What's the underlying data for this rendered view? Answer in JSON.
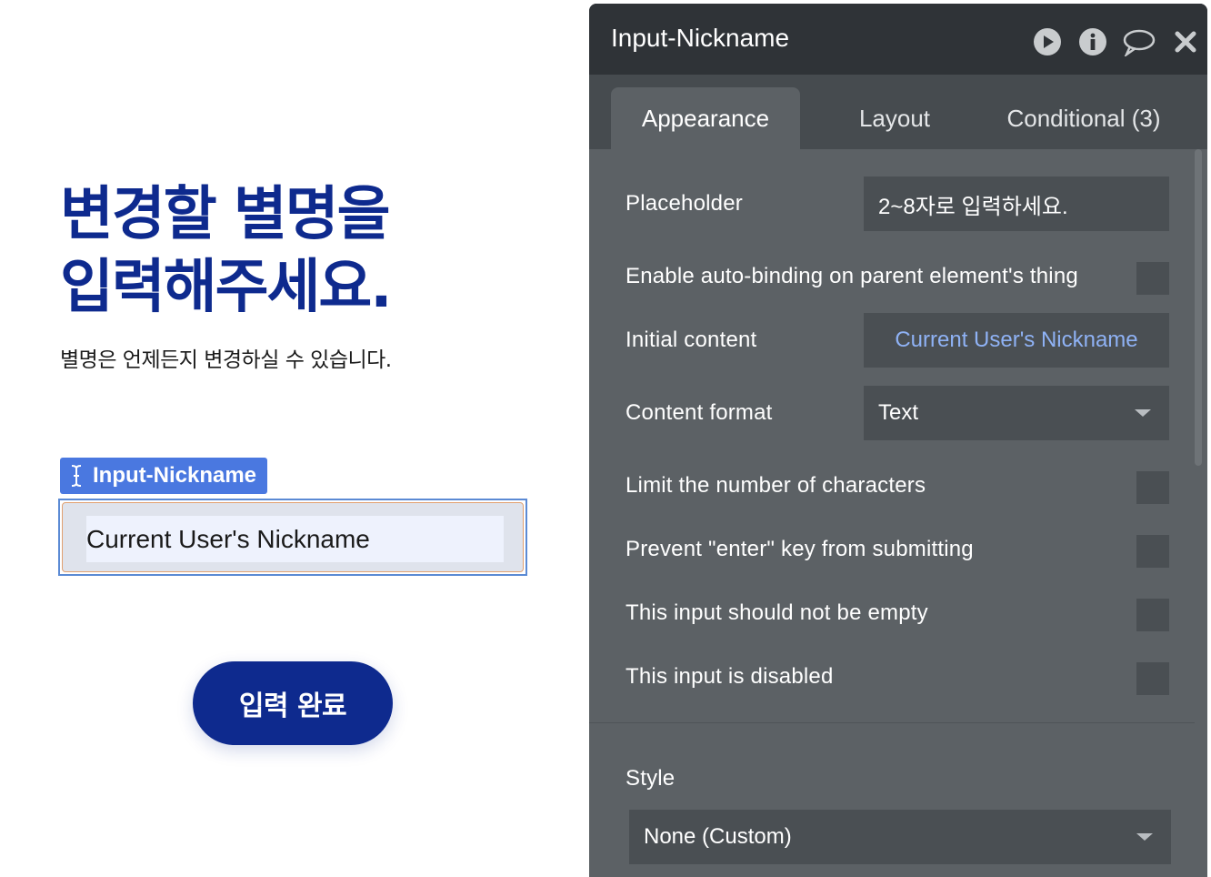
{
  "canvas": {
    "heading_line1": "변경할 별명을",
    "heading_line2": "입력해주세요.",
    "subtext": "별명은 언제든지 변경하실 수 있습니다.",
    "element_tag": "Input-Nickname",
    "input_value": "Current User's Nickname",
    "submit_label": "입력 완료"
  },
  "panel": {
    "title": "Input-Nickname",
    "header_icons": [
      "play-icon",
      "info-icon",
      "comment-icon",
      "close-icon"
    ],
    "tabs": [
      {
        "label": "Appearance",
        "active": true
      },
      {
        "label": "Layout",
        "active": false
      },
      {
        "label": "Conditional (3)",
        "active": false
      }
    ],
    "placeholder_label": "Placeholder",
    "placeholder_value": "2~8자로 입력하세요.",
    "autobinding_label": "Enable auto-binding on parent element's thing",
    "initial_content_label": "Initial content",
    "initial_content_value": "Current User's Nickname",
    "content_format_label": "Content format",
    "content_format_value": "Text",
    "limit_chars_label": "Limit the number of characters",
    "prevent_enter_label": "Prevent \"enter\" key from submitting",
    "not_empty_label": "This input should not be empty",
    "disabled_label": "This input is disabled",
    "style_label": "Style",
    "style_value": "None (Custom)"
  },
  "colors": {
    "brand_navy": "#0e2a8e",
    "tag_blue": "#4a78e0",
    "panel_bg": "#5c6165",
    "panel_header": "#2f3337",
    "dynamic_text": "#8fb2f5"
  }
}
